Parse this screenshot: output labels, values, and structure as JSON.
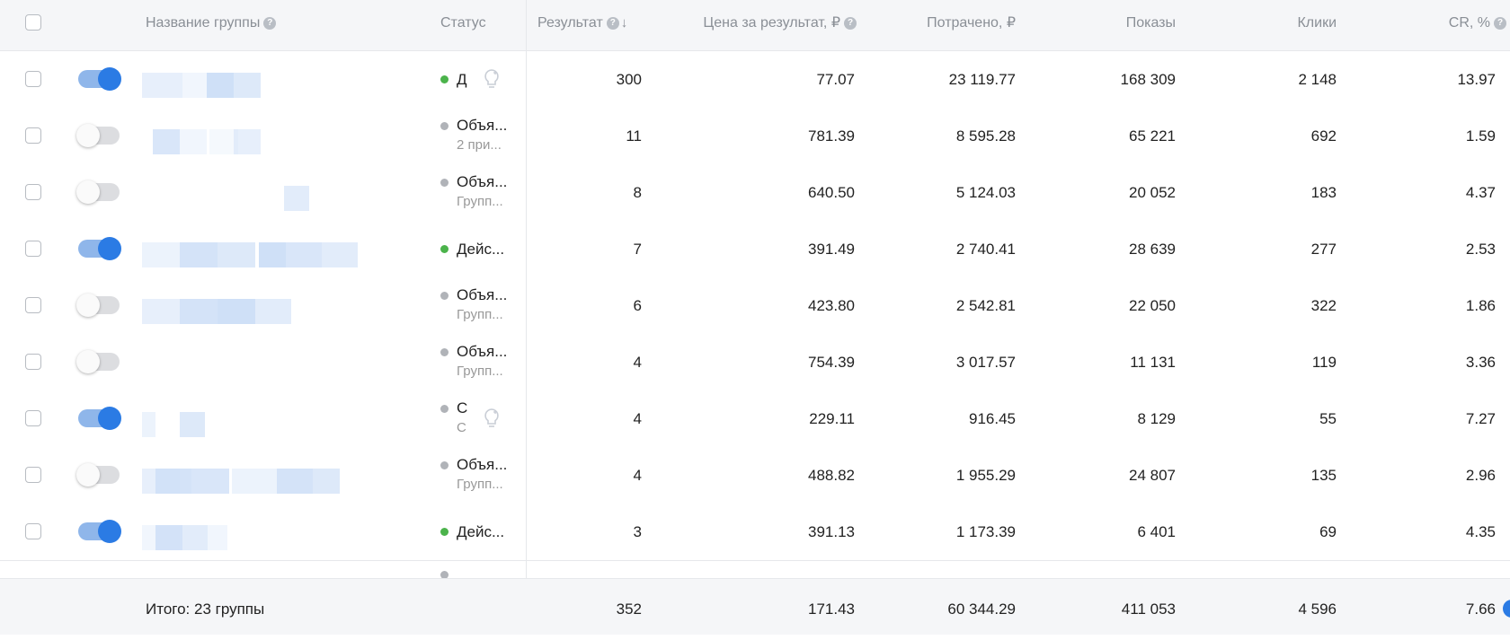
{
  "header": {
    "group_name": "Название группы",
    "status": "Статус",
    "result": "Результат",
    "price_per_result": "Цена за результат, ₽",
    "spent": "Потрачено, ₽",
    "impressions": "Показы",
    "clicks": "Клики",
    "cr": "CR, %",
    "sort_arrow": "↓",
    "help_glyph": "?"
  },
  "colors": {
    "active_dot": "#4bb34b",
    "inactive_dot": "#b0b3b8",
    "toggle_on": "#2b7be4",
    "blur_blue": "#cfe0f7"
  },
  "rows": [
    {
      "enabled": true,
      "status_dot": "active",
      "status_main": "Д",
      "status_sub": "",
      "bulb": true,
      "result": "300",
      "price": "77.07",
      "spent": "23 119.77",
      "impressions": "168 309",
      "clicks": "2 148",
      "cr": "13.97"
    },
    {
      "enabled": false,
      "status_dot": "inactive",
      "status_main": "Объя...",
      "status_sub": "2 при...",
      "bulb": false,
      "result": "11",
      "price": "781.39",
      "spent": "8 595.28",
      "impressions": "65 221",
      "clicks": "692",
      "cr": "1.59"
    },
    {
      "enabled": false,
      "status_dot": "inactive",
      "status_main": "Объя...",
      "status_sub": "Групп...",
      "bulb": false,
      "result": "8",
      "price": "640.50",
      "spent": "5 124.03",
      "impressions": "20 052",
      "clicks": "183",
      "cr": "4.37"
    },
    {
      "enabled": true,
      "status_dot": "active",
      "status_main": "Дейс...",
      "status_sub": "",
      "bulb": false,
      "result": "7",
      "price": "391.49",
      "spent": "2 740.41",
      "impressions": "28 639",
      "clicks": "277",
      "cr": "2.53"
    },
    {
      "enabled": false,
      "status_dot": "inactive",
      "status_main": "Объя...",
      "status_sub": "Групп...",
      "bulb": false,
      "result": "6",
      "price": "423.80",
      "spent": "2 542.81",
      "impressions": "22 050",
      "clicks": "322",
      "cr": "1.86"
    },
    {
      "enabled": false,
      "status_dot": "inactive",
      "status_main": "Объя...",
      "status_sub": "Групп...",
      "bulb": false,
      "result": "4",
      "price": "754.39",
      "spent": "3 017.57",
      "impressions": "11 131",
      "clicks": "119",
      "cr": "3.36"
    },
    {
      "enabled": true,
      "status_dot": "inactive",
      "status_main": "С",
      "status_sub": "С",
      "bulb": true,
      "result": "4",
      "price": "229.11",
      "spent": "916.45",
      "impressions": "8 129",
      "clicks": "55",
      "cr": "7.27"
    },
    {
      "enabled": false,
      "status_dot": "inactive",
      "status_main": "Объя...",
      "status_sub": "Групп...",
      "bulb": false,
      "result": "4",
      "price": "488.82",
      "spent": "1 955.29",
      "impressions": "24 807",
      "clicks": "135",
      "cr": "2.96"
    },
    {
      "enabled": true,
      "status_dot": "active",
      "status_main": "Дейс...",
      "status_sub": "",
      "bulb": false,
      "result": "3",
      "price": "391.13",
      "spent": "1 173.39",
      "impressions": "6 401",
      "clicks": "69",
      "cr": "4.35"
    }
  ],
  "footer": {
    "label": "Итого: 23 группы",
    "result": "352",
    "price": "171.43",
    "spent": "60 344.29",
    "impressions": "411 053",
    "clicks": "4 596",
    "cr": "7.66"
  }
}
